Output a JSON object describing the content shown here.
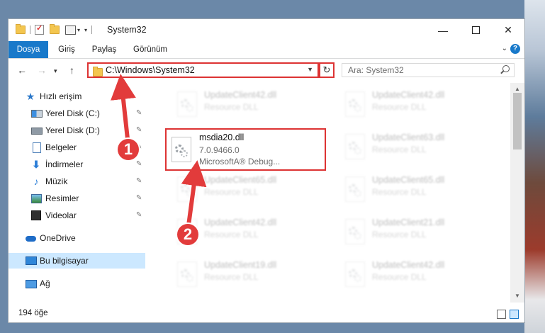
{
  "window": {
    "title": "System32"
  },
  "ribbon": {
    "tabs": [
      "Dosya",
      "Giriş",
      "Paylaş",
      "Görünüm"
    ]
  },
  "address": {
    "path": "C:\\Windows\\System32"
  },
  "search": {
    "placeholder": "Ara: System32"
  },
  "sidebar": {
    "items": [
      {
        "label": "Hızlı erişim",
        "icon": "star-icon"
      },
      {
        "label": "Yerel Disk (C:)",
        "icon": "drive-icon"
      },
      {
        "label": "Yerel Disk (D:)",
        "icon": "drive-icon"
      },
      {
        "label": "Belgeler",
        "icon": "document-icon"
      },
      {
        "label": "İndirmeler",
        "icon": "download-icon"
      },
      {
        "label": "Müzik",
        "icon": "music-icon"
      },
      {
        "label": "Resimler",
        "icon": "pictures-icon"
      },
      {
        "label": "Videolar",
        "icon": "video-icon"
      },
      {
        "label": "OneDrive",
        "icon": "cloud-icon"
      },
      {
        "label": "Bu bilgisayar",
        "icon": "computer-icon"
      },
      {
        "label": "Ağ",
        "icon": "network-icon"
      }
    ]
  },
  "files": {
    "left": [
      {
        "name": "UpdateClient42.dll",
        "desc": "Resource DLL"
      },
      {
        "name": "msdia20.dll",
        "version": "7.0.9466.0",
        "desc": "MicrosoftA® Debug..."
      },
      {
        "name": "UpdateClient65.dll",
        "desc": "Resource DLL"
      },
      {
        "name": "UpdateClient42.dll",
        "desc": "Resource DLL"
      },
      {
        "name": "UpdateClient19.dll",
        "desc": "Resource DLL"
      }
    ],
    "right": [
      {
        "name": "UpdateClient42.dll",
        "desc": "Resource DLL"
      },
      {
        "name": "UpdateClient63.dll",
        "desc": "Resource DLL"
      },
      {
        "name": "UpdateClient65.dll",
        "desc": "Resource DLL"
      },
      {
        "name": "UpdateClient21.dll",
        "desc": "Resource DLL"
      },
      {
        "name": "UpdateClient42.dll",
        "desc": "Resource DLL"
      }
    ]
  },
  "status": {
    "count": "194 öğe"
  },
  "callouts": [
    "1",
    "2"
  ],
  "colors": {
    "accent": "#1979ca",
    "highlight": "#d33333",
    "selection": "#cce8ff"
  }
}
